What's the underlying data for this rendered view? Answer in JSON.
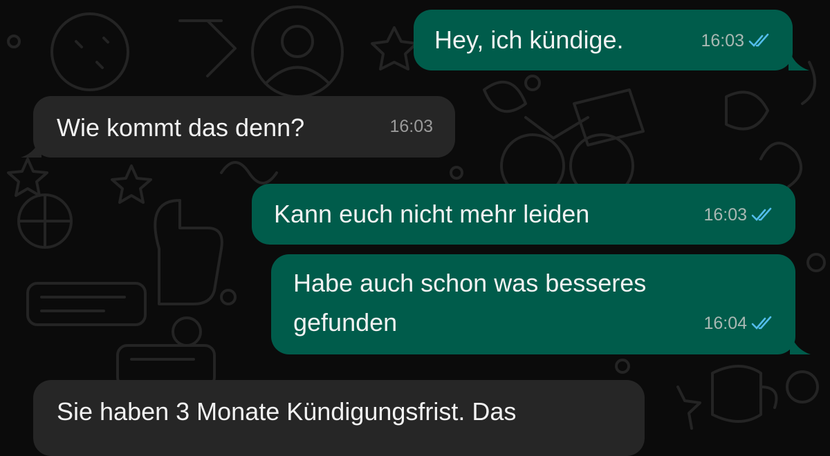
{
  "colors": {
    "background": "#0b0b0b",
    "outgoing_bubble": "#005c4b",
    "incoming_bubble": "#262626",
    "read_ticks": "#53bdeb"
  },
  "messages": [
    {
      "direction": "outgoing",
      "text": "Hey, ich kündige.",
      "time": "16:03",
      "status": "read"
    },
    {
      "direction": "incoming",
      "text": "Wie kommt das denn?",
      "time": "16:03"
    },
    {
      "direction": "outgoing",
      "text": "Kann euch nicht mehr leiden",
      "time": "16:03",
      "status": "read"
    },
    {
      "direction": "outgoing",
      "lines": [
        "Habe auch schon was besseres",
        "gefunden"
      ],
      "time": "16:04",
      "status": "read"
    },
    {
      "direction": "incoming",
      "text": "Sie haben 3 Monate Kündigungsfrist. Das"
    }
  ],
  "icons": {
    "read_receipt": "double-check-icon",
    "wallpaper": "doodle-pattern"
  }
}
